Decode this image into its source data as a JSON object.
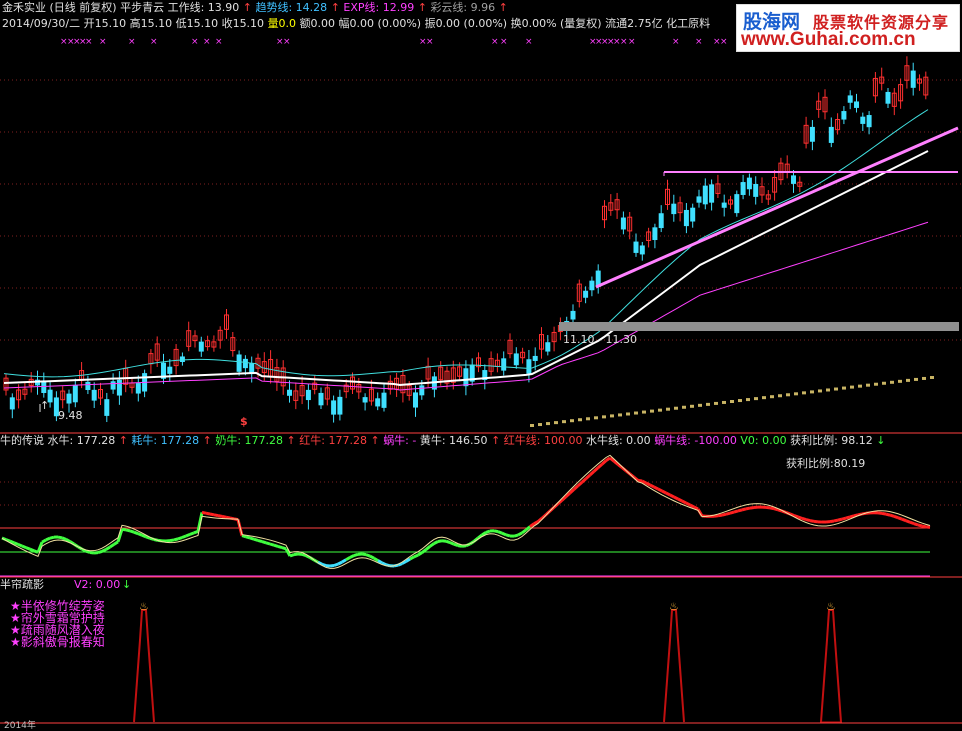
{
  "header": {
    "line1": [
      {
        "text": "金禾实业 (日线 前复权) 平步青云 工作线: 13.90",
        "color": "#e0e0e0"
      },
      {
        "text": "↑",
        "color": "#ff4040"
      },
      {
        "text": "趋势线: 14.28",
        "color": "#40c0ff"
      },
      {
        "text": "↑",
        "color": "#ff4040"
      },
      {
        "text": "EXP线: 12.99",
        "color": "#ff40ff"
      },
      {
        "text": "↑",
        "color": "#ff4040"
      },
      {
        "text": "彩云线: 9.96",
        "color": "#a0a0a0"
      },
      {
        "text": "↑",
        "color": "#ff4040"
      }
    ],
    "line2": [
      {
        "text": "2014/09/30/二 开15.10 高15.10 低15.10 收15.10",
        "color": "#e0e0e0"
      },
      {
        "text": "量0.0",
        "color": "#ffff00"
      },
      {
        "text": "额0.00 幅0.00 (0.00%) 振0.00 (0.00%) 换0.00% (量复权) 流通2.75亿 化工原料",
        "color": "#e0e0e0"
      }
    ]
  },
  "watermark": {
    "logo": "股海网",
    "tag": "股票软件资源分享",
    "url": "www.Guhai.com.cn"
  },
  "main_chart": {
    "support_label": "11.10 - 11.30",
    "low_label": "9.48",
    "dollar_marker": "$"
  },
  "indicator1": {
    "name": "牛的传说",
    "fields": [
      {
        "text": "水牛: 177.28",
        "color": "#e0e0e0"
      },
      {
        "text": "↑",
        "color": "#ff4040"
      },
      {
        "text": "耗牛: 177.28",
        "color": "#40c0ff"
      },
      {
        "text": "↑",
        "color": "#ff4040"
      },
      {
        "text": "奶牛: 177.28",
        "color": "#40ff40"
      },
      {
        "text": "↑",
        "color": "#ff4040"
      },
      {
        "text": "红牛: 177.28",
        "color": "#ff4040"
      },
      {
        "text": "↑",
        "color": "#ff4040"
      },
      {
        "text": "蜗牛: -",
        "color": "#ff40ff"
      },
      {
        "text": "黄牛: 146.50",
        "color": "#e0e0e0"
      },
      {
        "text": "↑",
        "color": "#ff4040"
      },
      {
        "text": "红牛线: 100.00",
        "color": "#ff4040"
      },
      {
        "text": "水牛线: 0.00",
        "color": "#e0e0e0"
      },
      {
        "text": "蜗牛线: -100.00",
        "color": "#ff40ff"
      },
      {
        "text": "V0: 0.00",
        "color": "#40ff40"
      },
      {
        "text": "获利比例: 98.12",
        "color": "#e0e0e0"
      },
      {
        "text": "↓",
        "color": "#40ff40"
      }
    ],
    "profit_label": "获利比例:80.19"
  },
  "indicator2": {
    "name": "半帘疏影",
    "v2": "V2: 0.00",
    "v2_arrow": "↓",
    "poem": [
      "★半依修竹绽芳姿",
      "★帘外雪霜常护持",
      "★疏雨随风潜入夜",
      "★影斜傲骨报春知"
    ],
    "year_label": "2014年"
  },
  "colors": {
    "background": "#000000",
    "up": "#ff3030",
    "down": "#40e0ff",
    "grid": "#802020",
    "axis": "#ff4040",
    "work_line": "#ffffff",
    "trend_line": "#40e0e0",
    "exp_line": "#ff40ff",
    "rail": "#ff80ff",
    "support": "#909090"
  }
}
